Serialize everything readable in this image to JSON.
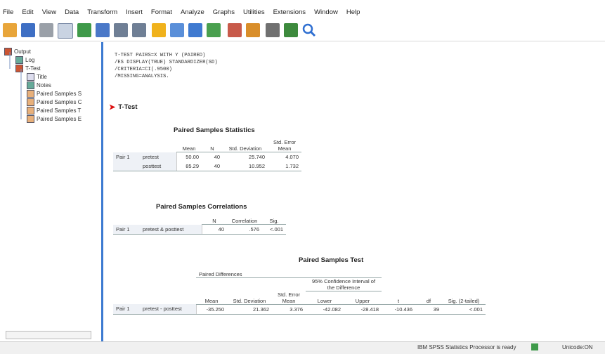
{
  "menu": [
    "File",
    "Edit",
    "View",
    "Data",
    "Transform",
    "Insert",
    "Format",
    "Analyze",
    "Graphs",
    "Utilities",
    "Extensions",
    "Window",
    "Help"
  ],
  "toolbar_icons": [
    "open-folder-icon",
    "save-icon",
    "print-icon",
    "print-preview-icon",
    "export-icon",
    "recall-dialog-icon",
    "undo-icon",
    "redo-icon",
    "goto-data-icon",
    "goto-case-icon",
    "goto-variable-icon",
    "variables-icon",
    "insert-output-icon",
    "designate-window-icon",
    "hide-icon",
    "show-icon",
    "search-icon"
  ],
  "nav": {
    "items": [
      {
        "label": "Output",
        "level": 0,
        "icon": "output-icon"
      },
      {
        "label": "Log",
        "level": 1,
        "icon": "log-icon"
      },
      {
        "label": "T-Test",
        "level": 1,
        "icon": "ttest-icon"
      },
      {
        "label": "Title",
        "level": 2,
        "icon": "title-icon"
      },
      {
        "label": "Notes",
        "level": 2,
        "icon": "notes-icon"
      },
      {
        "label": "Paired Samples S",
        "level": 2,
        "icon": "table-icon"
      },
      {
        "label": "Paired Samples C",
        "level": 2,
        "icon": "table-icon"
      },
      {
        "label": "Paired Samples T",
        "level": 2,
        "icon": "table-icon"
      },
      {
        "label": "Paired Samples E",
        "level": 2,
        "icon": "table-icon"
      }
    ]
  },
  "syntax_lines": [
    "T-TEST PAIRS=X WITH Y (PAIRED)",
    "  /ES DISPLAY(TRUE) STANDARDIZER(SD)",
    "  /CRITERIA=CI(.9500)",
    "  /MISSING=ANALYSIS."
  ],
  "section_heading": "T-Test",
  "stats": {
    "title": "Paired Samples Statistics",
    "headers": [
      "Mean",
      "N",
      "Std. Deviation",
      "Std. Error Mean"
    ],
    "pair_label": "Pair 1",
    "rows": [
      {
        "var": "pretest",
        "mean": "50.00",
        "n": "40",
        "sd": "25.740",
        "se": "4.070"
      },
      {
        "var": "posttest",
        "mean": "85.29",
        "n": "40",
        "sd": "10.952",
        "se": "1.732"
      }
    ]
  },
  "corr": {
    "title": "Paired Samples Correlations",
    "headers": [
      "N",
      "Correlation",
      "Sig."
    ],
    "row": {
      "pair": "Pair 1",
      "var": "pretest & posttest",
      "n": "40",
      "corr": ".576",
      "sig": "<.001"
    }
  },
  "ptest": {
    "title": "Paired Samples Test",
    "group_header": "Paired Differences",
    "ci_header": "95% Confidence Interval of the Difference",
    "headers": [
      "Mean",
      "Std. Deviation",
      "Std. Error Mean",
      "Lower",
      "Upper",
      "t",
      "df",
      "Sig. (2-tailed)"
    ],
    "row": {
      "pair": "Pair 1",
      "var": "pretest - posttest",
      "mean": "-35.250",
      "sd": "21.362",
      "se": "3.376",
      "lower": "-42.082",
      "upper": "-28.418",
      "t": "-10.436",
      "df": "39",
      "sig": "<.001"
    }
  },
  "status": {
    "left": "IBM SPSS Statistics Processor is ready",
    "right": "Unicode:ON"
  },
  "colors": {
    "brand_blue": "#3c7ad1",
    "arrow_red": "#d11111"
  }
}
